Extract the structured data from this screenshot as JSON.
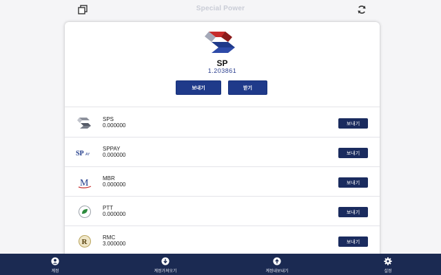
{
  "app": {
    "title": "Special Power"
  },
  "icons": {
    "copy": "copy-icon",
    "refresh": "refresh-icon"
  },
  "main_token": {
    "name": "SP",
    "balance": "1.203861",
    "send_label": "보내기",
    "receive_label": "받기"
  },
  "tokens": [
    {
      "name": "SPS",
      "balance": "0.000000",
      "send_label": "보내기",
      "icon": "sps-logo-icon"
    },
    {
      "name": "SPPAY",
      "balance": "0.000000",
      "send_label": "보내기",
      "icon": "sppay-logo-icon"
    },
    {
      "name": "MBR",
      "balance": "0.000000",
      "send_label": "보내기",
      "icon": "mbr-logo-icon"
    },
    {
      "name": "PTT",
      "balance": "0.000000",
      "send_label": "보내기",
      "icon": "ptt-logo-icon"
    },
    {
      "name": "RMC",
      "balance": "3.000000",
      "send_label": "보내기",
      "icon": "rmc-logo-icon"
    }
  ],
  "bottom_nav": [
    {
      "label": "계정",
      "icon": "user-icon"
    },
    {
      "label": "계정가져오기",
      "icon": "download-icon"
    },
    {
      "label": "계정내보내기",
      "icon": "upload-icon"
    },
    {
      "label": "설정",
      "icon": "gear-icon"
    }
  ],
  "colors": {
    "accent": "#1f3a8a",
    "nav_bg": "#1b2a52",
    "row_button": "#1a2b5e",
    "logo_red": "#c62b2b"
  }
}
